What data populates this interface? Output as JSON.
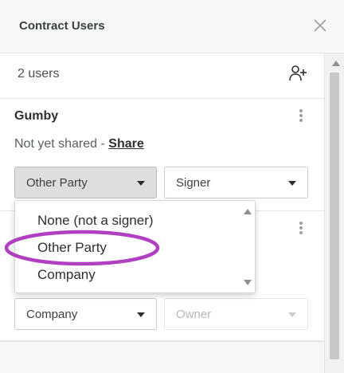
{
  "header": {
    "title": "Contract Users",
    "close_icon": "close-icon"
  },
  "users_bar": {
    "count_label": "2 users",
    "add_icon": "add-user-icon"
  },
  "users": [
    {
      "name": "Gumby",
      "status_text": "Not yet shared - ",
      "share_link": "Share",
      "party": "Other Party",
      "role": "Signer"
    },
    {
      "name": "",
      "party": "Company",
      "role": "Owner"
    }
  ],
  "dropdown": {
    "options": [
      "None (not a signer)",
      "Other Party",
      "Company"
    ],
    "highlighted": "Other Party"
  },
  "colors": {
    "highlight_ring": "#b03fc1",
    "active_select": "#dedede",
    "header_bg": "#f7f7f7"
  }
}
